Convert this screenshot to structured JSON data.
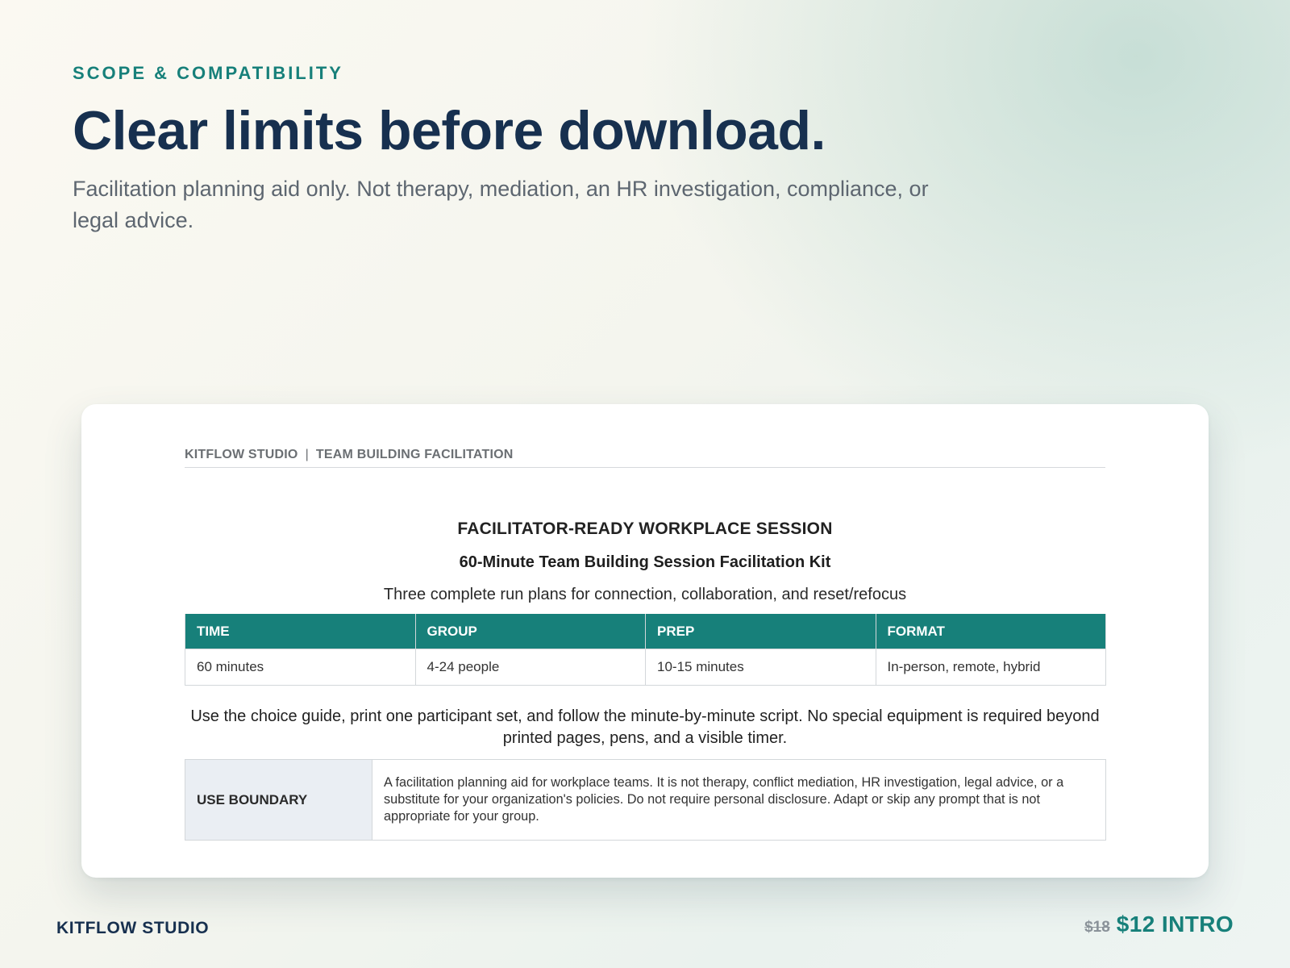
{
  "hero": {
    "eyebrow": "SCOPE & COMPATIBILITY",
    "headline": "Clear limits before download.",
    "subtext": "Facilitation planning aid only. Not therapy, mediation, an HR investigation, compliance, or legal advice."
  },
  "document": {
    "header_brand": "KITFLOW STUDIO",
    "header_separator": "|",
    "header_section": "TEAM BUILDING FACILITATION",
    "kicker": "FACILITATOR-READY WORKPLACE SESSION",
    "title": "60-Minute Team Building Session Facilitation Kit",
    "tagline": "Three complete run plans for connection, collaboration, and reset/refocus",
    "facts_headers": [
      "TIME",
      "GROUP",
      "PREP",
      "FORMAT"
    ],
    "facts_values": [
      "60 minutes",
      "4-24 people",
      "10-15 minutes",
      "In-person, remote, hybrid"
    ],
    "instructions": "Use the choice guide, print one participant set, and follow the minute-by-minute script. No special equipment is required beyond printed pages, pens, and a visible timer.",
    "boundary_label": "USE BOUNDARY",
    "boundary_text": "A facilitation planning aid for workplace teams. It is not therapy, conflict mediation, HR investigation, legal advice, or a substitute for your organization's policies. Do not require personal disclosure. Adapt or skip any prompt that is not appropriate for your group."
  },
  "footer": {
    "brand": "KITFLOW STUDIO",
    "old_price": "$18",
    "new_price": "$12 INTRO"
  },
  "colors": {
    "accent_teal": "#17807a",
    "navy": "#17304f",
    "boundary_label_bg": "#eaeef3"
  }
}
